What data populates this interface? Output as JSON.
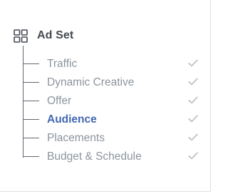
{
  "section": {
    "title": "Ad Set",
    "icon": "grid-icon"
  },
  "colors": {
    "active": "#4267b2",
    "inactive_text": "#8d949e",
    "tree_line": "#606770",
    "check": "#bec3c9"
  },
  "items": [
    {
      "label": "Traffic",
      "active": false,
      "completed": true
    },
    {
      "label": "Dynamic Creative",
      "active": false,
      "completed": true
    },
    {
      "label": "Offer",
      "active": false,
      "completed": true
    },
    {
      "label": "Audience",
      "active": true,
      "completed": true
    },
    {
      "label": "Placements",
      "active": false,
      "completed": true
    },
    {
      "label": "Budget & Schedule",
      "active": false,
      "completed": true
    }
  ]
}
